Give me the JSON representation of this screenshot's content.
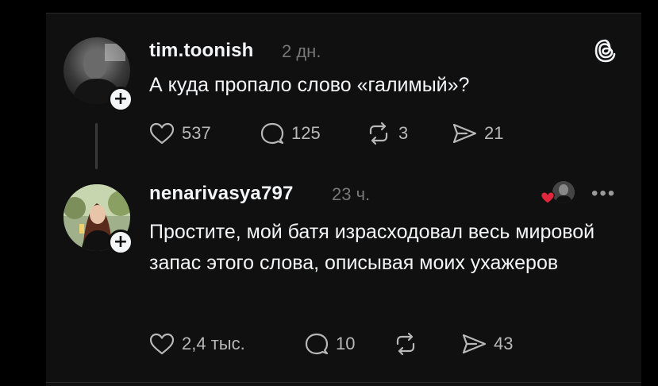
{
  "posts": [
    {
      "username": "tim.toonish",
      "time": "2 дн.",
      "text": "А куда пропало слово «галимый»?",
      "actions": {
        "likes": "537",
        "replies": "125",
        "reposts": "3",
        "shares": "21"
      }
    },
    {
      "username": "nenarivasya797",
      "time": "23 ч.",
      "text": "Простите, мой батя израсходовал весь мировой запас этого слова, описывая моих ухажеров",
      "actions": {
        "likes": "2,4 тыс.",
        "replies": "10",
        "reposts": "",
        "shares": "43"
      }
    }
  ],
  "icons": [
    "threads-logo-icon",
    "heart-icon",
    "comment-icon",
    "repost-icon",
    "send-icon",
    "more-icon"
  ],
  "colors": {
    "background": "#101010",
    "text": "#f3f5f7",
    "muted": "#777777",
    "like_red": "#e0263c"
  }
}
